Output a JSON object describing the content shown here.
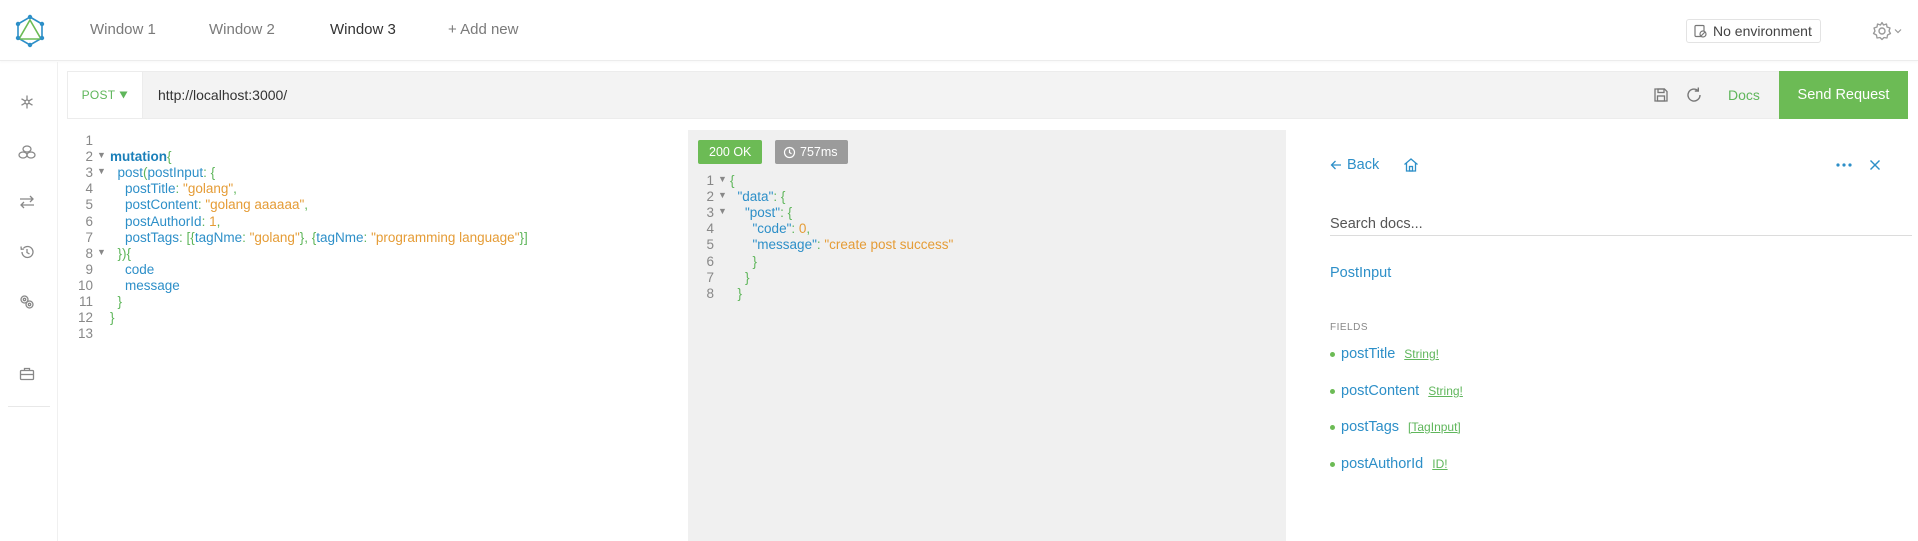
{
  "header": {
    "tabs": [
      {
        "label": "Window 1",
        "active": false
      },
      {
        "label": "Window 2",
        "active": false
      },
      {
        "label": "Window 3",
        "active": true
      }
    ],
    "add_new": "+ Add new",
    "environment": "No environment"
  },
  "sidebar": {
    "icons": [
      "schema-icon",
      "collections-icon",
      "pre-request-icon",
      "history-icon",
      "plugins-icon",
      "briefcase-icon"
    ]
  },
  "request": {
    "method": "POST",
    "url": "http://localhost:3000/",
    "docs_label": "Docs",
    "send_label": "Send Request"
  },
  "query": {
    "lines": [
      {
        "n": "1",
        "fold": false,
        "tokens": []
      },
      {
        "n": "2",
        "fold": true,
        "tokens": [
          [
            "kw",
            "mutation"
          ],
          [
            "pun",
            "{"
          ]
        ]
      },
      {
        "n": "3",
        "fold": true,
        "tokens": [
          [
            "fld",
            "  post"
          ],
          [
            "pun",
            "("
          ],
          [
            "arg",
            "postInput"
          ],
          [
            "pun",
            ": {"
          ]
        ]
      },
      {
        "n": "4",
        "fold": false,
        "tokens": [
          [
            "arg",
            "    postTitle"
          ],
          [
            "pun",
            ": "
          ],
          [
            "str",
            "\"golang\""
          ],
          [
            "pun",
            ","
          ]
        ]
      },
      {
        "n": "5",
        "fold": false,
        "tokens": [
          [
            "arg",
            "    postContent"
          ],
          [
            "pun",
            ": "
          ],
          [
            "str",
            "\"golang aaaaaa\""
          ],
          [
            "pun",
            ","
          ]
        ]
      },
      {
        "n": "6",
        "fold": false,
        "tokens": [
          [
            "arg",
            "    postAuthorId"
          ],
          [
            "pun",
            ": "
          ],
          [
            "num",
            "1"
          ],
          [
            "pun",
            ","
          ]
        ]
      },
      {
        "n": "7",
        "fold": false,
        "tokens": [
          [
            "arg",
            "    postTags"
          ],
          [
            "pun",
            ": [{"
          ],
          [
            "arg",
            "tagNme"
          ],
          [
            "pun",
            ": "
          ],
          [
            "str",
            "\"golang\""
          ],
          [
            "pun",
            "}, {"
          ],
          [
            "arg",
            "tagNme"
          ],
          [
            "pun",
            ": "
          ],
          [
            "str",
            "\"programming language\""
          ],
          [
            "pun",
            "}]"
          ]
        ]
      },
      {
        "n": "8",
        "fold": true,
        "tokens": [
          [
            "pun",
            "  }){"
          ]
        ]
      },
      {
        "n": "9",
        "fold": false,
        "tokens": [
          [
            "fld",
            "    code"
          ]
        ]
      },
      {
        "n": "10",
        "fold": false,
        "tokens": [
          [
            "fld",
            "    message"
          ]
        ]
      },
      {
        "n": "11",
        "fold": false,
        "tokens": [
          [
            "pun",
            "  }"
          ]
        ]
      },
      {
        "n": "12",
        "fold": false,
        "tokens": [
          [
            "pun",
            "}"
          ]
        ]
      },
      {
        "n": "13",
        "fold": false,
        "tokens": []
      }
    ]
  },
  "response": {
    "status": "200 OK",
    "time": "757ms",
    "lines": [
      {
        "n": "1",
        "fold": true,
        "tokens": [
          [
            "pun",
            "{"
          ]
        ]
      },
      {
        "n": "2",
        "fold": true,
        "tokens": [
          [
            "key",
            "  \"data\""
          ],
          [
            "pun",
            ": {"
          ]
        ]
      },
      {
        "n": "3",
        "fold": true,
        "tokens": [
          [
            "key",
            "    \"post\""
          ],
          [
            "pun",
            ": {"
          ]
        ]
      },
      {
        "n": "4",
        "fold": false,
        "tokens": [
          [
            "key",
            "      \"code\""
          ],
          [
            "pun",
            ": "
          ],
          [
            "num",
            "0"
          ],
          [
            "pun",
            ","
          ]
        ]
      },
      {
        "n": "5",
        "fold": false,
        "tokens": [
          [
            "key",
            "      \"message\""
          ],
          [
            "pun",
            ": "
          ],
          [
            "str",
            "\"create post success\""
          ]
        ]
      },
      {
        "n": "6",
        "fold": false,
        "tokens": [
          [
            "pun",
            "      }"
          ]
        ]
      },
      {
        "n": "7",
        "fold": false,
        "tokens": [
          [
            "pun",
            "    }"
          ]
        ]
      },
      {
        "n": "8",
        "fold": false,
        "tokens": [
          [
            "pun",
            "  }"
          ]
        ]
      }
    ]
  },
  "docs": {
    "back_label": "Back",
    "search_placeholder": "Search docs...",
    "type_title": "PostInput",
    "fields_heading": "FIELDS",
    "fields": [
      {
        "name": "postTitle",
        "type": "String!"
      },
      {
        "name": "postContent",
        "type": "String!"
      },
      {
        "name": "postTags",
        "type": "[TagInput]"
      },
      {
        "name": "postAuthorId",
        "type": "ID!"
      }
    ]
  },
  "colors": {
    "accent_green": "#6cbb55",
    "link_blue": "#2d8fc8",
    "string_orange": "#e59c36"
  }
}
